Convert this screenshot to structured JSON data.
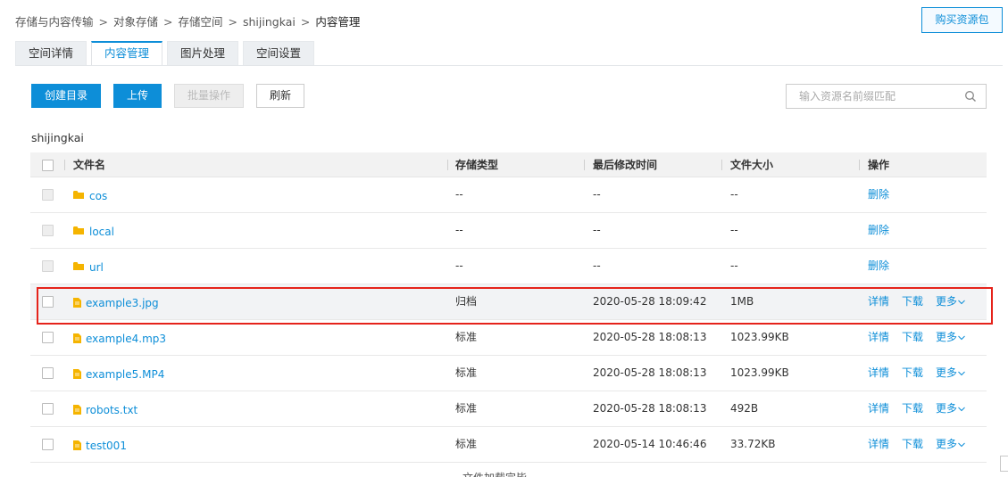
{
  "breadcrumb": {
    "items": [
      "存储与内容传输",
      "对象存储",
      "存储空间",
      "shijingkai"
    ],
    "current": "内容管理",
    "separator": ">"
  },
  "header": {
    "buy_button": "购买资源包"
  },
  "tabs": [
    {
      "label": "空间详情",
      "active": false
    },
    {
      "label": "内容管理",
      "active": true
    },
    {
      "label": "图片处理",
      "active": false
    },
    {
      "label": "空间设置",
      "active": false
    }
  ],
  "toolbar": {
    "create_dir": "创建目录",
    "upload": "上传",
    "batch": "批量操作",
    "refresh": "刷新"
  },
  "search": {
    "placeholder": "输入资源名前缀匹配",
    "icon": "search-icon"
  },
  "bucket_name": "shijingkai",
  "table": {
    "headers": {
      "name": "文件名",
      "storage": "存储类型",
      "modified": "最后修改时间",
      "size": "文件大小",
      "ops": "操作"
    },
    "folder_rows": [
      {
        "name": "cos",
        "storage": "--",
        "modified": "--",
        "size": "--",
        "delete": "删除"
      },
      {
        "name": "local",
        "storage": "--",
        "modified": "--",
        "size": "--",
        "delete": "删除"
      },
      {
        "name": "url",
        "storage": "--",
        "modified": "--",
        "size": "--",
        "delete": "删除"
      }
    ],
    "file_rows": [
      {
        "name": "example3.jpg",
        "storage": "归档",
        "modified": "2020-05-28 18:09:42",
        "size": "1MB",
        "highlighted": true
      },
      {
        "name": "example4.mp3",
        "storage": "标准",
        "modified": "2020-05-28 18:08:13",
        "size": "1023.99KB",
        "highlighted": false
      },
      {
        "name": "example5.MP4",
        "storage": "标准",
        "modified": "2020-05-28 18:08:13",
        "size": "1023.99KB",
        "highlighted": false
      },
      {
        "name": "robots.txt",
        "storage": "标准",
        "modified": "2020-05-28 18:08:13",
        "size": "492B",
        "highlighted": false
      },
      {
        "name": "test001",
        "storage": "标准",
        "modified": "2020-05-14 10:46:46",
        "size": "33.72KB",
        "highlighted": false
      }
    ],
    "ops": {
      "detail": "详情",
      "download": "下载",
      "more": "更多"
    }
  },
  "footer": {
    "loaded_text": "文件加载完毕"
  },
  "colors": {
    "accent": "#0d8ed8",
    "highlight_border": "#e5231b",
    "folder": "#f5b400"
  }
}
